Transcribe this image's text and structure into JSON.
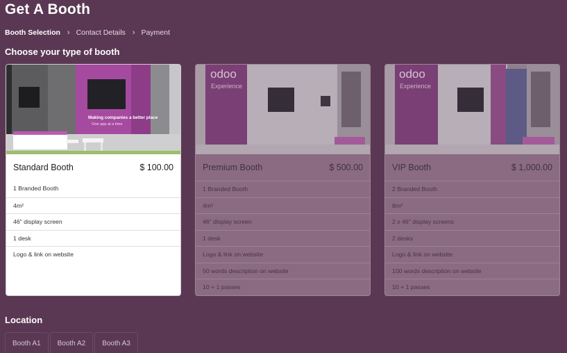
{
  "page": {
    "title": "Get A Booth",
    "breadcrumb": [
      "Booth Selection",
      "Contact Details",
      "Payment"
    ],
    "section_title": "Choose your type of booth",
    "location_title": "Location"
  },
  "colors": {
    "background": "#5a3853",
    "selected_card": "#ffffff",
    "dimmed_card": "#8a6b81"
  },
  "booths": [
    {
      "name": "Standard Booth",
      "price": "$ 100.00",
      "selected": true,
      "image_text": [
        "Making companies a better place",
        "One app at a time"
      ],
      "features": [
        "1 Branded Booth",
        "4m²",
        "46\" display screen",
        "1 desk",
        "Logo & link on website"
      ]
    },
    {
      "name": "Premium Booth",
      "price": "$ 500.00",
      "selected": false,
      "image_text": [
        "odoo",
        "Experience"
      ],
      "features": [
        "1 Branded Booth",
        "4m²",
        "46\" display screen",
        "1 desk",
        "Logo & link on website",
        "50 words description on website",
        "10 + 1 passes"
      ]
    },
    {
      "name": "VIP Booth",
      "price": "$ 1,000.00",
      "selected": false,
      "image_text": [
        "odoo",
        "Experience"
      ],
      "features": [
        "2 Branded Booth",
        "8m²",
        "2 x 46\" display screens",
        "2 desks",
        "Logo & link on website",
        "100 words description on website",
        "10 + 1 passes"
      ]
    }
  ],
  "locations": [
    "Booth A1",
    "Booth A2",
    "Booth A3"
  ]
}
